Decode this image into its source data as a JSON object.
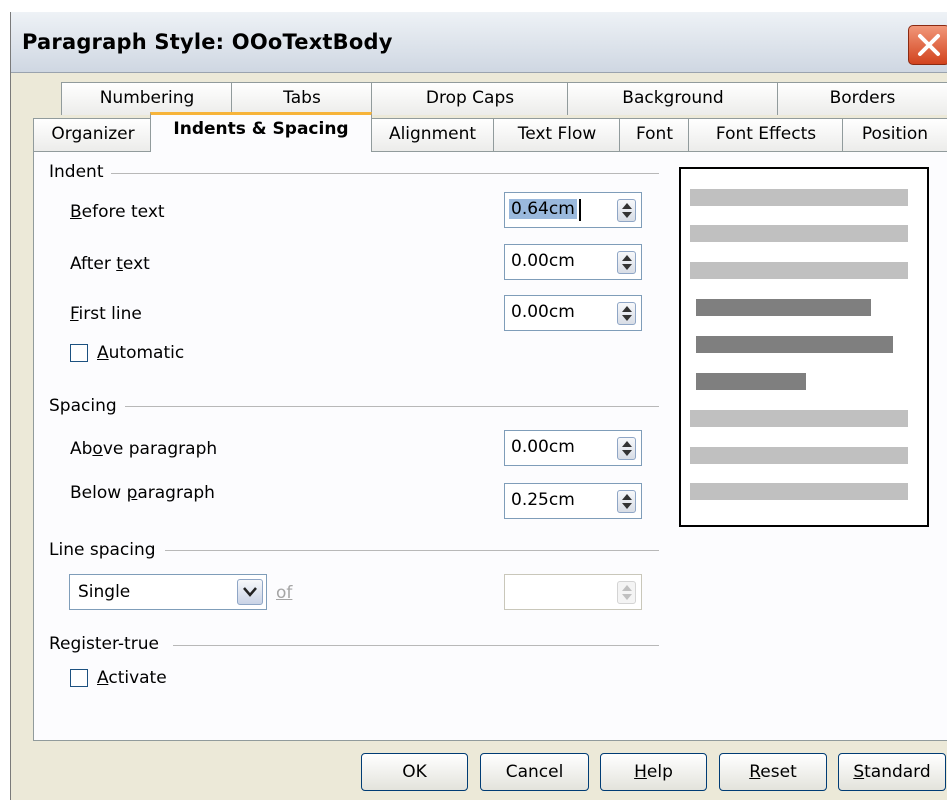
{
  "window": {
    "title": "Paragraph Style: OOoTextBody"
  },
  "tabs_row1": [
    "Numbering",
    "Tabs",
    "Drop Caps",
    "Background",
    "Borders"
  ],
  "tabs_row2": [
    "Organizer",
    "Indents & Spacing",
    "Alignment",
    "Text Flow",
    "Font",
    "Font Effects",
    "Position"
  ],
  "active_tab": "Indents & Spacing",
  "indent": {
    "heading": "Indent",
    "before_text": {
      "label": "Before text",
      "value": "0.64cm"
    },
    "after_text": {
      "label": "After text",
      "value": "0.00cm"
    },
    "first_line": {
      "label": "First line",
      "value": "0.00cm"
    },
    "automatic": {
      "label": "Automatic",
      "checked": false
    }
  },
  "spacing": {
    "heading": "Spacing",
    "above": {
      "label": "Above paragraph",
      "value": "0.00cm"
    },
    "below": {
      "label": "Below paragraph",
      "value": "0.25cm"
    }
  },
  "line_spacing": {
    "heading": "Line spacing",
    "mode": "Single",
    "of_label": "of",
    "of_value": ""
  },
  "register_true": {
    "heading": "Register-true",
    "activate": {
      "label": "Activate",
      "checked": false
    }
  },
  "buttons": {
    "ok": "OK",
    "cancel": "Cancel",
    "help": "Help",
    "reset": "Reset",
    "standard": "Standard"
  },
  "colors": {
    "preview_light": "#c0c0c0",
    "preview_dark": "#7f7f7f",
    "tab_highlight": "#f7b43a",
    "dialog_bg": "#ece9d8"
  }
}
